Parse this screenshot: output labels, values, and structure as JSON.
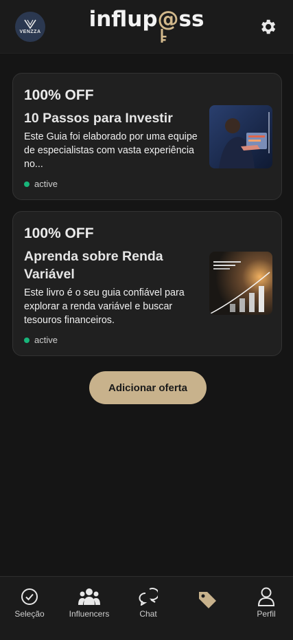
{
  "header": {
    "avatar_text": "VENZZA",
    "logo_prefix": "influp",
    "logo_at": "@",
    "logo_suffix": "ss"
  },
  "offers": [
    {
      "discount": "100% OFF",
      "title": "10 Passos para Investir",
      "description": "Este Guia foi elaborado por uma equipe de especialistas com vasta experiência no...",
      "status": "active"
    },
    {
      "discount": "100% OFF",
      "title": "Aprenda sobre Renda Variável",
      "description": "Este livro é o seu guia confiável para explorar a renda variável e buscar tesouros financeiros.",
      "status": "active"
    }
  ],
  "add_button": "Adicionar oferta",
  "nav": {
    "selecao": "Seleção",
    "influencers": "Influencers",
    "chat": "Chat",
    "ofertas": "",
    "perfil": "Perfil"
  },
  "colors": {
    "accent": "#c8b28c",
    "status_active": "#18b57a",
    "background": "#151515"
  }
}
